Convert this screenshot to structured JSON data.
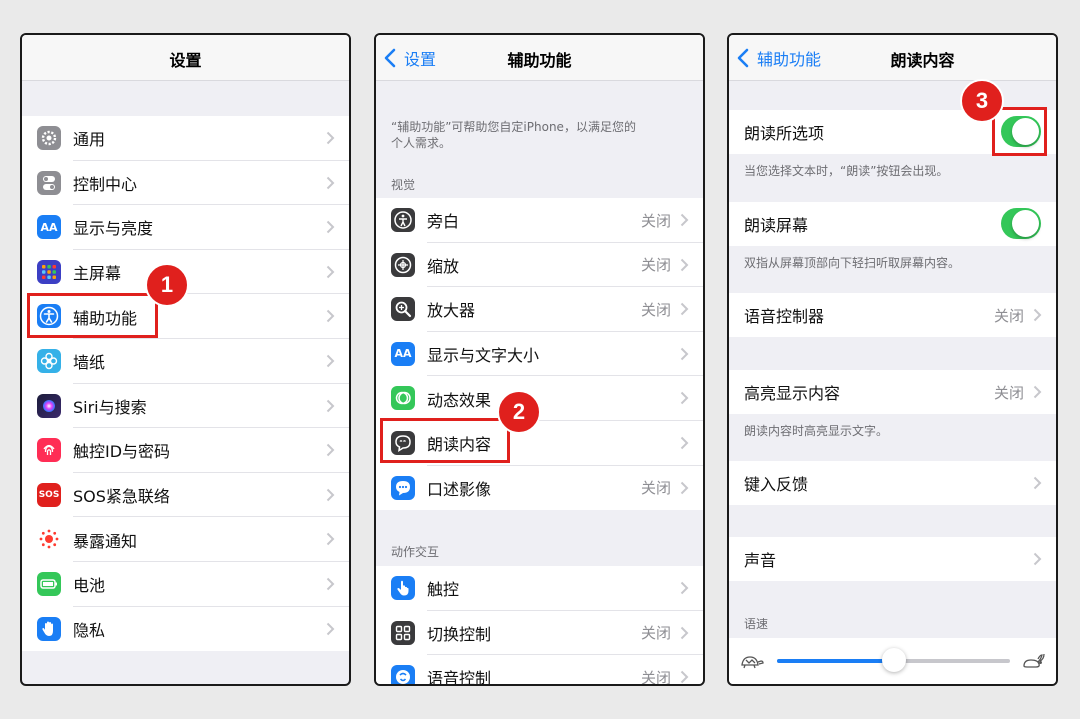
{
  "colors": {
    "accent": "#1a7ef5",
    "toggle_on": "#34c759",
    "annotation": "#e0201d"
  },
  "panel1": {
    "title": "设置",
    "items": [
      {
        "label": "通用",
        "icon": "gear-icon"
      },
      {
        "label": "控制中心",
        "icon": "switches-icon"
      },
      {
        "label": "显示与亮度",
        "icon": "text-size-icon",
        "glyph": "AA"
      },
      {
        "label": "主屏幕",
        "icon": "home-grid-icon"
      },
      {
        "label": "辅助功能",
        "icon": "accessibility-icon"
      },
      {
        "label": "墙纸",
        "icon": "flower-icon"
      },
      {
        "label": "Siri与搜索",
        "icon": "siri-icon"
      },
      {
        "label": "触控ID与密码",
        "icon": "fingerprint-icon"
      },
      {
        "label": "SOS紧急联络",
        "icon": "sos-icon",
        "glyph": "SOS"
      },
      {
        "label": "暴露通知",
        "icon": "exposure-icon"
      },
      {
        "label": "电池",
        "icon": "battery-icon"
      },
      {
        "label": "隐私",
        "icon": "hand-icon"
      }
    ]
  },
  "panel2": {
    "back": "设置",
    "title": "辅助功能",
    "intro": [
      "“辅助功能”可帮助您自定iPhone，以满足您的",
      "个人需求。"
    ],
    "section_vision": "视觉",
    "vision_items": [
      {
        "label": "旁白",
        "value": "关闭",
        "icon": "voiceover-icon"
      },
      {
        "label": "缩放",
        "value": "关闭",
        "icon": "zoom-icon"
      },
      {
        "label": "放大器",
        "value": "关闭",
        "icon": "magnifier-icon"
      },
      {
        "label": "显示与文字大小",
        "value": "",
        "icon": "text-size-icon",
        "glyph": "AA"
      },
      {
        "label": "动态效果",
        "value": "",
        "icon": "motion-icon"
      },
      {
        "label": "朗读内容",
        "value": "",
        "icon": "speech-icon"
      },
      {
        "label": "口述影像",
        "value": "关闭",
        "icon": "audio-description-icon"
      }
    ],
    "section_interaction": "动作交互",
    "interaction_items": [
      {
        "label": "触控",
        "value": "",
        "icon": "touch-icon"
      },
      {
        "label": "切换控制",
        "value": "关闭",
        "icon": "switch-control-icon"
      },
      {
        "label": "语音控制",
        "value": "关闭",
        "icon": "voice-control-icon"
      }
    ]
  },
  "panel3": {
    "back": "辅助功能",
    "title": "朗读内容",
    "speak_selection": "朗读所选项",
    "speak_selection_note": "当您选择文本时，“朗读”按钮会出现。",
    "speak_screen": "朗读屏幕",
    "speak_screen_note": "双指从屏幕顶部向下轻扫听取屏幕内容。",
    "speech_controller": "语音控制器",
    "speech_controller_value": "关闭",
    "highlight": "高亮显示内容",
    "highlight_value": "关闭",
    "highlight_note": "朗读内容时高亮显示文字。",
    "typing_feedback": "键入反馈",
    "voices": "声音",
    "rate_header": "语速",
    "rate_level": 0.5
  },
  "annotations": {
    "one": "1",
    "two": "2",
    "three": "3"
  }
}
